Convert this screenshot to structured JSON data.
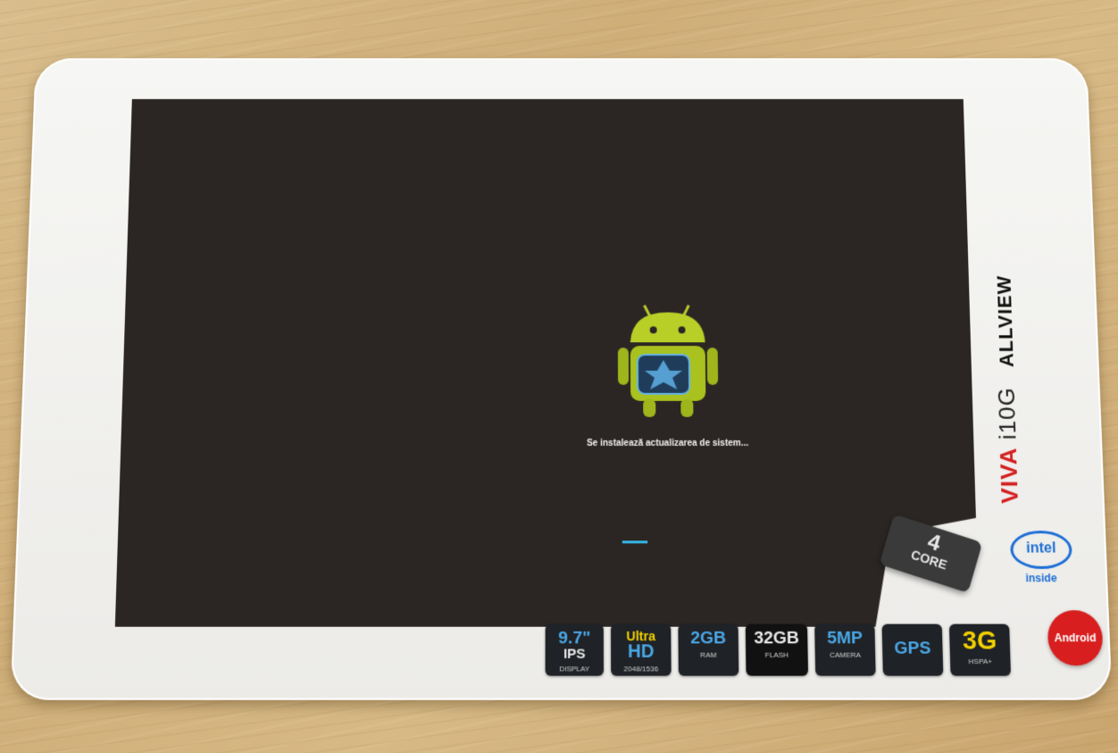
{
  "screen": {
    "status_text": "Se instalează actualizarea de sistem...",
    "progress_color": "#33b5e5"
  },
  "branding": {
    "product": "VIVA i10G",
    "viva": "VIVA",
    "model": "i10G",
    "maker": "ALLVIEW",
    "core": {
      "number": "4",
      "label": "CORE"
    },
    "intel": {
      "logo": "intel",
      "inside": "inside"
    },
    "android_badge": "Android"
  },
  "specs": [
    {
      "big": "9.7\"",
      "mid": "IPS",
      "small": "DISPLAY"
    },
    {
      "big": "Ultra",
      "mid": "HD",
      "small": "2048/1536"
    },
    {
      "big": "2GB",
      "mid": "",
      "small": "RAM"
    },
    {
      "big": "32GB",
      "mid": "",
      "small": "FLASH"
    },
    {
      "big": "5MP",
      "mid": "",
      "small": "CAMERA"
    },
    {
      "big": "GPS",
      "mid": "",
      "small": ""
    },
    {
      "big": "3G",
      "mid": "",
      "small": "HSPA+"
    }
  ]
}
